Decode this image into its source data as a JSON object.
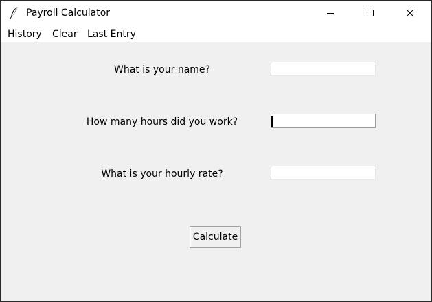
{
  "window": {
    "title": "Payroll Calculator",
    "icon": "feather-icon"
  },
  "menu": {
    "items": [
      {
        "label": "History"
      },
      {
        "label": "Clear"
      },
      {
        "label": "Last Entry"
      }
    ]
  },
  "form": {
    "name_label": "What is your name?",
    "name_value": "",
    "hours_label": "How many hours did you work?",
    "hours_value": "",
    "rate_label": "What is your hourly rate?",
    "rate_value": "",
    "calculate_label": "Calculate"
  }
}
